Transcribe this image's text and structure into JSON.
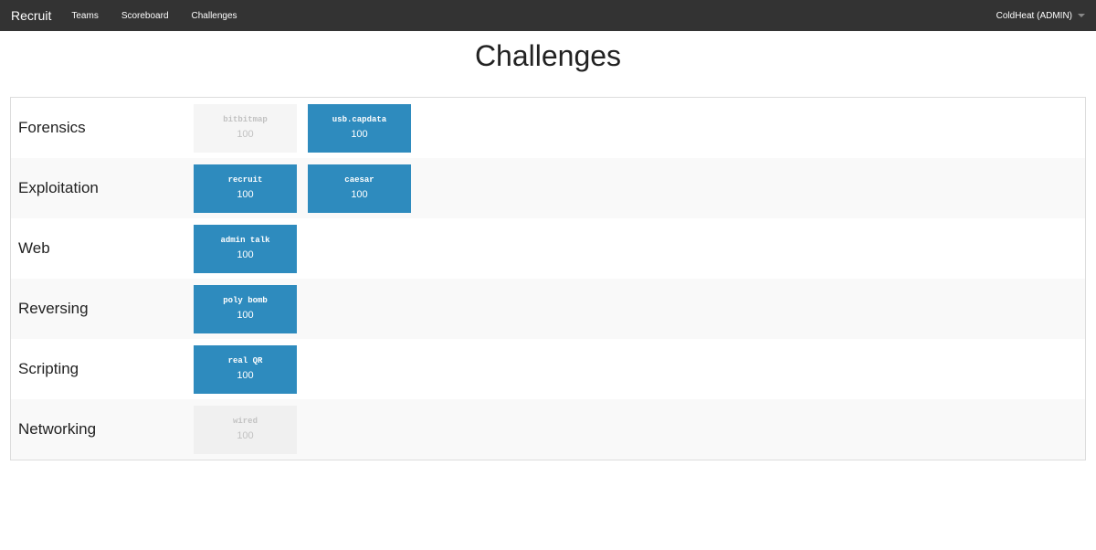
{
  "navbar": {
    "brand": "Recruit",
    "links": [
      "Teams",
      "Scoreboard",
      "Challenges"
    ],
    "user": "ColdHeat (ADMIN)"
  },
  "page": {
    "title": "Challenges"
  },
  "categories": [
    {
      "name": "Forensics",
      "challenges": [
        {
          "name": "bitbitmap",
          "value": "100",
          "solved": true
        },
        {
          "name": "usb.capdata",
          "value": "100",
          "solved": false
        }
      ]
    },
    {
      "name": "Exploitation",
      "challenges": [
        {
          "name": "recruit",
          "value": "100",
          "solved": false
        },
        {
          "name": "caesar",
          "value": "100",
          "solved": false
        }
      ]
    },
    {
      "name": "Web",
      "challenges": [
        {
          "name": "admin talk",
          "value": "100",
          "solved": false
        }
      ]
    },
    {
      "name": "Reversing",
      "challenges": [
        {
          "name": "poly bomb",
          "value": "100",
          "solved": false
        }
      ]
    },
    {
      "name": "Scripting",
      "challenges": [
        {
          "name": "real QR",
          "value": "100",
          "solved": false
        }
      ]
    },
    {
      "name": "Networking",
      "challenges": [
        {
          "name": "wired",
          "value": "100",
          "solved": true
        }
      ]
    }
  ],
  "colors": {
    "unsolved": "#2e8bbe",
    "solved": "#f5f5f5",
    "navbar": "#333333"
  }
}
